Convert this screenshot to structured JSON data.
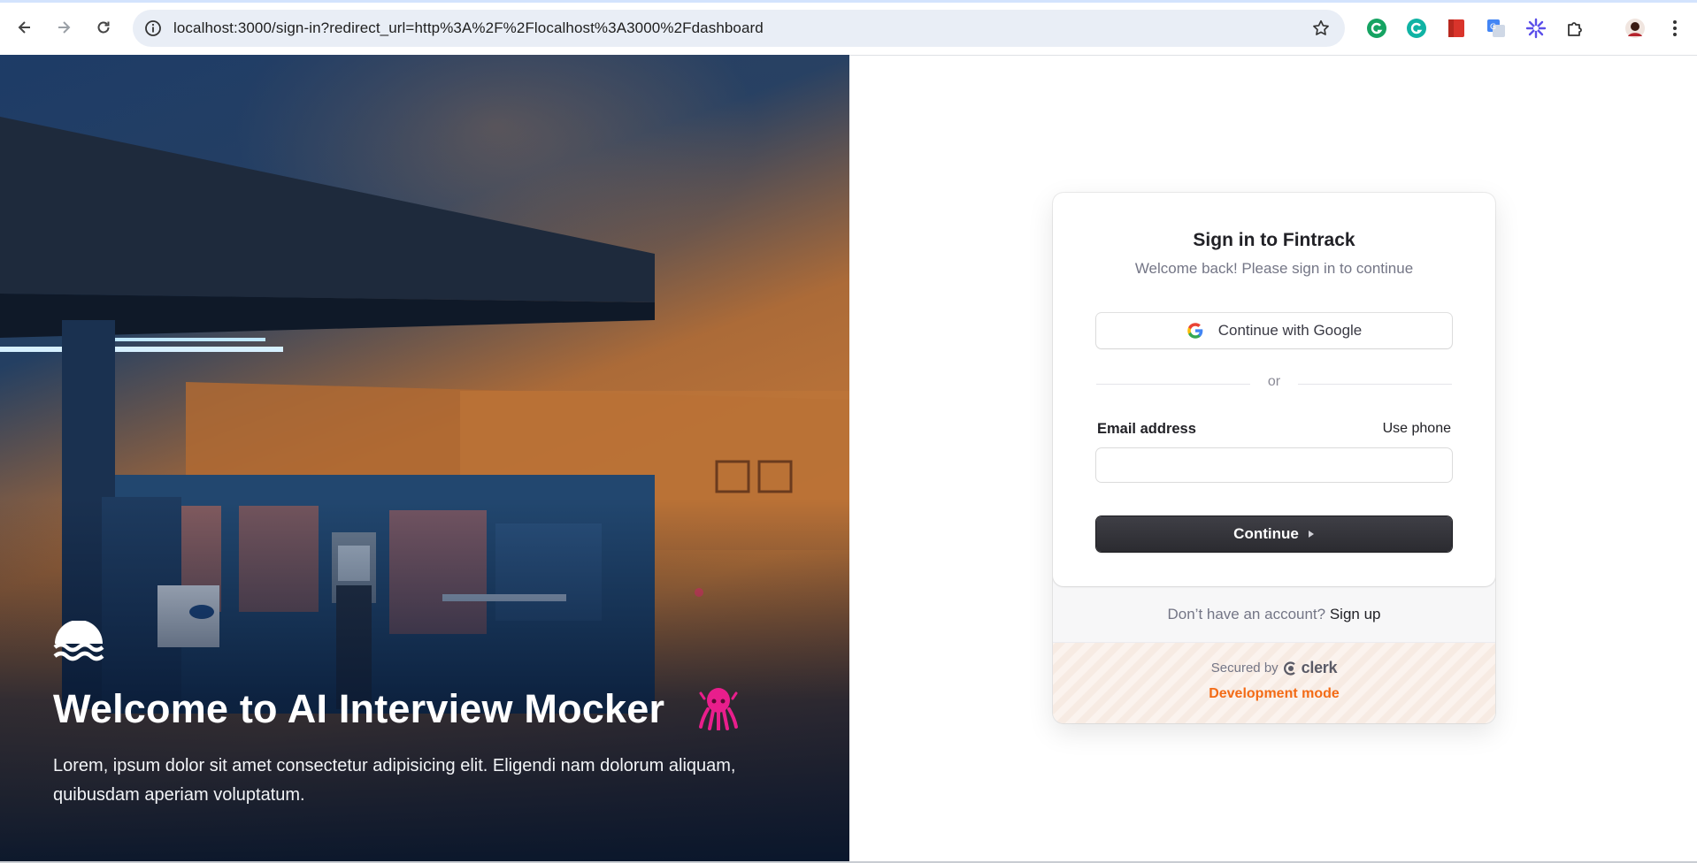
{
  "browser": {
    "url": "localhost:3000/sign-in?redirect_url=http%3A%2F%2Flocalhost%3A3000%2Fdashboard",
    "icons": [
      "back-icon",
      "forward-icon",
      "reload-icon",
      "site-info-icon",
      "bookmark-star-icon",
      "grammarly-icon",
      "grammarly-go-icon",
      "pdf-reader-icon",
      "google-translate-icon",
      "snowflake-extension-icon",
      "extensions-puzzle-icon",
      "profile-avatar",
      "kebab-menu-icon"
    ]
  },
  "hero": {
    "title": "Welcome to AI Interview Mocker",
    "description": "Lorem, ipsum dolor sit amet consectetur adipisicing elit. Eligendi nam dolorum aliquam, quibusdam aperiam voluptatum.",
    "logo_icon": "waves-logo-icon",
    "emoji_icon": "octopus-icon",
    "accent": "#e91e8c"
  },
  "signin": {
    "title": "Sign in to Fintrack",
    "subtitle": "Welcome back! Please sign in to continue",
    "google_button": "Continue with Google",
    "divider": "or",
    "email_label": "Email address",
    "use_phone": "Use phone",
    "email_value": "",
    "continue_button": "Continue",
    "no_account": "Don’t have an account?",
    "sign_up": "Sign up",
    "secured_by": "Secured by",
    "clerk": "clerk",
    "dev_mode": "Development mode",
    "dev_mode_color": "#f36b16"
  }
}
